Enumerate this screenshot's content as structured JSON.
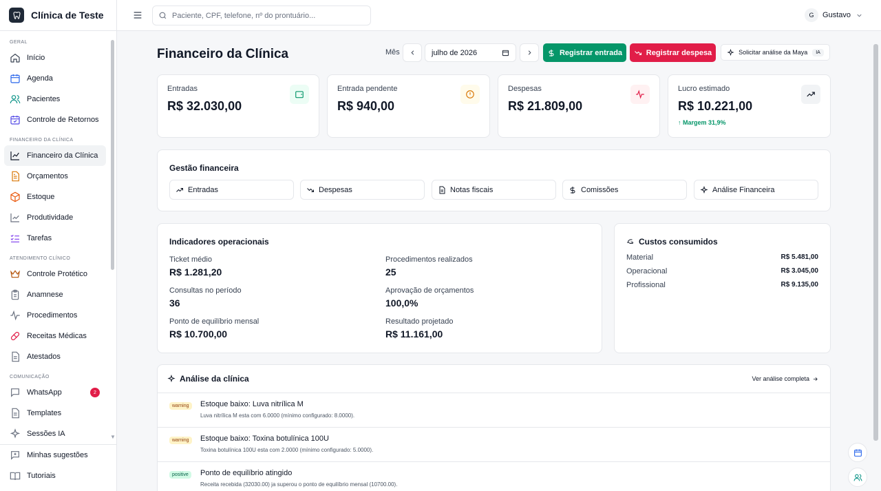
{
  "brand": {
    "name": "Clínica de Teste"
  },
  "search": {
    "placeholder": "Paciente, CPF, telefone, nº do prontuário..."
  },
  "user": {
    "initial": "G",
    "name": "Gustavo"
  },
  "sidebar": {
    "sections": [
      {
        "label": "GERAL",
        "items": [
          {
            "label": "Início",
            "icon": "home-icon"
          },
          {
            "label": "Agenda",
            "icon": "calendar-icon"
          },
          {
            "label": "Pacientes",
            "icon": "users-icon"
          },
          {
            "label": "Controle de Retornos",
            "icon": "calendar-check-icon"
          }
        ]
      },
      {
        "label": "FINANCEIRO DA CLÍNICA",
        "items": [
          {
            "label": "Financeiro da Clínica",
            "icon": "chart-line-icon",
            "active": true
          },
          {
            "label": "Orçamentos",
            "icon": "file-text-icon"
          },
          {
            "label": "Estoque",
            "icon": "package-icon"
          },
          {
            "label": "Produtividade",
            "icon": "trend-icon"
          },
          {
            "label": "Tarefas",
            "icon": "list-check-icon"
          }
        ]
      },
      {
        "label": "ATENDIMENTO CLÍNICO",
        "items": [
          {
            "label": "Controle Protético",
            "icon": "crown-icon"
          },
          {
            "label": "Anamnese",
            "icon": "clipboard-icon"
          },
          {
            "label": "Procedimentos",
            "icon": "activity-icon"
          },
          {
            "label": "Receitas Médicas",
            "icon": "pill-icon"
          },
          {
            "label": "Atestados",
            "icon": "document-icon"
          }
        ]
      },
      {
        "label": "COMUNICAÇÃO",
        "items": [
          {
            "label": "WhatsApp",
            "icon": "message-icon",
            "badge": "2"
          },
          {
            "label": "Templates",
            "icon": "template-icon"
          },
          {
            "label": "Sessões IA",
            "icon": "sparkle-icon"
          }
        ]
      }
    ],
    "bottom": [
      {
        "label": "Minhas sugestões",
        "icon": "feedback-icon"
      },
      {
        "label": "Tutoriais",
        "icon": "book-icon"
      }
    ]
  },
  "header": {
    "title": "Financeiro da Clínica",
    "month_label": "Mês",
    "month_value": "julho de 2026",
    "register_income": "Registrar entrada",
    "register_expense": "Registrar despesa",
    "ask_maya": "Solicitar análise da Maya",
    "ia_tag": "IA"
  },
  "kpis": [
    {
      "label": "Entradas",
      "value": "R$ 32.030,00",
      "icon": "wallet-icon",
      "color": "#059669",
      "bg": "#ecfdf5"
    },
    {
      "label": "Entrada pendente",
      "value": "R$ 940,00",
      "icon": "alert-circle-icon",
      "color": "#d97706",
      "bg": "#fffbeb"
    },
    {
      "label": "Despesas",
      "value": "R$ 21.809,00",
      "icon": "pulse-icon",
      "color": "#e11d48",
      "bg": "#fff1f2"
    },
    {
      "label": "Lucro estimado",
      "value": "R$ 10.221,00",
      "icon": "trending-up-icon",
      "color": "#111827",
      "bg": "#f1f3f5",
      "note": "Margem 31,9%"
    }
  ],
  "management": {
    "title": "Gestão financeira",
    "tabs": [
      {
        "label": "Entradas",
        "icon": "trending-up-icon"
      },
      {
        "label": "Despesas",
        "icon": "trending-down-icon"
      },
      {
        "label": "Notas fiscais",
        "icon": "receipt-icon"
      },
      {
        "label": "Comissões",
        "icon": "dollar-icon"
      },
      {
        "label": "Análise Financeira",
        "icon": "sparkle-icon"
      }
    ]
  },
  "indicators": {
    "title": "Indicadores operacionais",
    "items": [
      {
        "label": "Ticket médio",
        "value": "R$ 1.281,20"
      },
      {
        "label": "Procedimentos realizados",
        "value": "25"
      },
      {
        "label": "Consultas no período",
        "value": "36"
      },
      {
        "label": "Aprovação de orçamentos",
        "value": "100,0%"
      },
      {
        "label": "Ponto de equilíbrio mensal",
        "value": "R$ 10.700,00"
      },
      {
        "label": "Resultado projetado",
        "value": "R$ 11.161,00"
      }
    ]
  },
  "costs": {
    "title": "Custos consumidos",
    "items": [
      {
        "label": "Material",
        "value": "R$ 5.481,00"
      },
      {
        "label": "Operacional",
        "value": "R$ 3.045,00"
      },
      {
        "label": "Profissional",
        "value": "R$ 9.135,00"
      }
    ]
  },
  "analysis": {
    "title": "Análise da clínica",
    "view_all": "Ver análise completa",
    "alerts": [
      {
        "tag": "warning",
        "title": "Estoque baixo: Luva nitrílica M",
        "desc": "Luva nitrílica M esta com 6.0000 (mínimo configurado: 8.0000)."
      },
      {
        "tag": "warning",
        "title": "Estoque baixo: Toxina botulínica 100U",
        "desc": "Toxina botulínica 100U esta com 2.0000 (mínimo configurado: 5.0000)."
      },
      {
        "tag": "positive",
        "title": "Ponto de equilíbrio atingido",
        "desc": "Receita recebida (32030.00) ja superou o ponto de equilíbrio mensal (10700.00)."
      }
    ]
  }
}
